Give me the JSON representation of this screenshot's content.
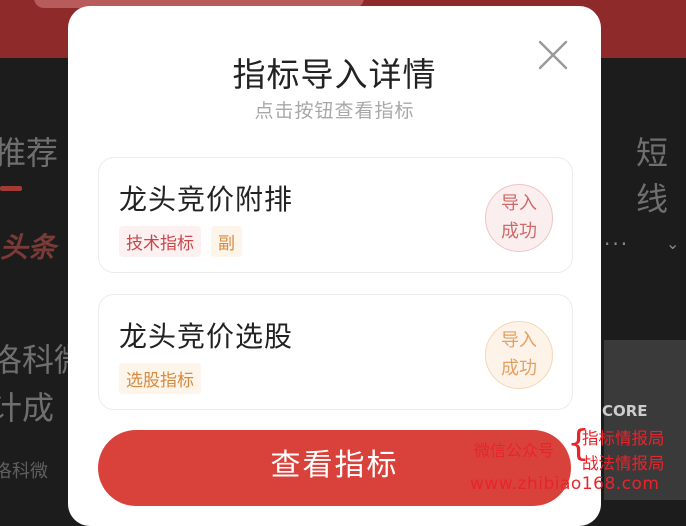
{
  "background": {
    "tab_left": "推荐",
    "tab_right": "短线",
    "toutiao": "头条",
    "news_line1": "洛科微",
    "news_line2": "计成",
    "news_line3": "洛科微",
    "dots": "···",
    "logo_text": "CORE"
  },
  "modal": {
    "title": "指标导入详情",
    "subtitle": "点击按钮查看指标",
    "view_button": "查看指标"
  },
  "indicators": [
    {
      "name": "龙头竞价附排",
      "tags": [
        "技术指标",
        "副"
      ],
      "status_line1": "导入",
      "status_line2": "成功"
    },
    {
      "name": "龙头竞价选股",
      "tags": [
        "选股指标"
      ],
      "status_line1": "导入",
      "status_line2": "成功"
    }
  ],
  "watermark": {
    "left": "微信公众号",
    "right_line1": "指标情报局",
    "right_line2": "战法情报局",
    "url": "www.zhibiao168.com"
  },
  "colors": {
    "primary_button": "#d9423b",
    "tag_red_text": "#c9474a",
    "tag_orange_text": "#d98a3e",
    "watermark": "#e8242b"
  }
}
